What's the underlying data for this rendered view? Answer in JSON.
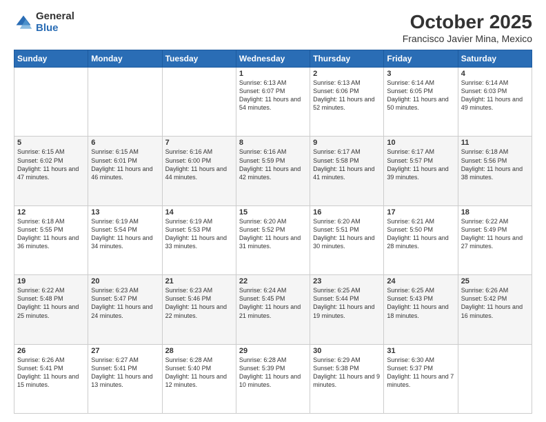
{
  "header": {
    "logo_general": "General",
    "logo_blue": "Blue",
    "month_title": "October 2025",
    "location": "Francisco Javier Mina, Mexico"
  },
  "days_of_week": [
    "Sunday",
    "Monday",
    "Tuesday",
    "Wednesday",
    "Thursday",
    "Friday",
    "Saturday"
  ],
  "weeks": [
    [
      {
        "day": "",
        "sunrise": "",
        "sunset": "",
        "daylight": ""
      },
      {
        "day": "",
        "sunrise": "",
        "sunset": "",
        "daylight": ""
      },
      {
        "day": "",
        "sunrise": "",
        "sunset": "",
        "daylight": ""
      },
      {
        "day": "1",
        "sunrise": "Sunrise: 6:13 AM",
        "sunset": "Sunset: 6:07 PM",
        "daylight": "Daylight: 11 hours and 54 minutes."
      },
      {
        "day": "2",
        "sunrise": "Sunrise: 6:13 AM",
        "sunset": "Sunset: 6:06 PM",
        "daylight": "Daylight: 11 hours and 52 minutes."
      },
      {
        "day": "3",
        "sunrise": "Sunrise: 6:14 AM",
        "sunset": "Sunset: 6:05 PM",
        "daylight": "Daylight: 11 hours and 50 minutes."
      },
      {
        "day": "4",
        "sunrise": "Sunrise: 6:14 AM",
        "sunset": "Sunset: 6:03 PM",
        "daylight": "Daylight: 11 hours and 49 minutes."
      }
    ],
    [
      {
        "day": "5",
        "sunrise": "Sunrise: 6:15 AM",
        "sunset": "Sunset: 6:02 PM",
        "daylight": "Daylight: 11 hours and 47 minutes."
      },
      {
        "day": "6",
        "sunrise": "Sunrise: 6:15 AM",
        "sunset": "Sunset: 6:01 PM",
        "daylight": "Daylight: 11 hours and 46 minutes."
      },
      {
        "day": "7",
        "sunrise": "Sunrise: 6:16 AM",
        "sunset": "Sunset: 6:00 PM",
        "daylight": "Daylight: 11 hours and 44 minutes."
      },
      {
        "day": "8",
        "sunrise": "Sunrise: 6:16 AM",
        "sunset": "Sunset: 5:59 PM",
        "daylight": "Daylight: 11 hours and 42 minutes."
      },
      {
        "day": "9",
        "sunrise": "Sunrise: 6:17 AM",
        "sunset": "Sunset: 5:58 PM",
        "daylight": "Daylight: 11 hours and 41 minutes."
      },
      {
        "day": "10",
        "sunrise": "Sunrise: 6:17 AM",
        "sunset": "Sunset: 5:57 PM",
        "daylight": "Daylight: 11 hours and 39 minutes."
      },
      {
        "day": "11",
        "sunrise": "Sunrise: 6:18 AM",
        "sunset": "Sunset: 5:56 PM",
        "daylight": "Daylight: 11 hours and 38 minutes."
      }
    ],
    [
      {
        "day": "12",
        "sunrise": "Sunrise: 6:18 AM",
        "sunset": "Sunset: 5:55 PM",
        "daylight": "Daylight: 11 hours and 36 minutes."
      },
      {
        "day": "13",
        "sunrise": "Sunrise: 6:19 AM",
        "sunset": "Sunset: 5:54 PM",
        "daylight": "Daylight: 11 hours and 34 minutes."
      },
      {
        "day": "14",
        "sunrise": "Sunrise: 6:19 AM",
        "sunset": "Sunset: 5:53 PM",
        "daylight": "Daylight: 11 hours and 33 minutes."
      },
      {
        "day": "15",
        "sunrise": "Sunrise: 6:20 AM",
        "sunset": "Sunset: 5:52 PM",
        "daylight": "Daylight: 11 hours and 31 minutes."
      },
      {
        "day": "16",
        "sunrise": "Sunrise: 6:20 AM",
        "sunset": "Sunset: 5:51 PM",
        "daylight": "Daylight: 11 hours and 30 minutes."
      },
      {
        "day": "17",
        "sunrise": "Sunrise: 6:21 AM",
        "sunset": "Sunset: 5:50 PM",
        "daylight": "Daylight: 11 hours and 28 minutes."
      },
      {
        "day": "18",
        "sunrise": "Sunrise: 6:22 AM",
        "sunset": "Sunset: 5:49 PM",
        "daylight": "Daylight: 11 hours and 27 minutes."
      }
    ],
    [
      {
        "day": "19",
        "sunrise": "Sunrise: 6:22 AM",
        "sunset": "Sunset: 5:48 PM",
        "daylight": "Daylight: 11 hours and 25 minutes."
      },
      {
        "day": "20",
        "sunrise": "Sunrise: 6:23 AM",
        "sunset": "Sunset: 5:47 PM",
        "daylight": "Daylight: 11 hours and 24 minutes."
      },
      {
        "day": "21",
        "sunrise": "Sunrise: 6:23 AM",
        "sunset": "Sunset: 5:46 PM",
        "daylight": "Daylight: 11 hours and 22 minutes."
      },
      {
        "day": "22",
        "sunrise": "Sunrise: 6:24 AM",
        "sunset": "Sunset: 5:45 PM",
        "daylight": "Daylight: 11 hours and 21 minutes."
      },
      {
        "day": "23",
        "sunrise": "Sunrise: 6:25 AM",
        "sunset": "Sunset: 5:44 PM",
        "daylight": "Daylight: 11 hours and 19 minutes."
      },
      {
        "day": "24",
        "sunrise": "Sunrise: 6:25 AM",
        "sunset": "Sunset: 5:43 PM",
        "daylight": "Daylight: 11 hours and 18 minutes."
      },
      {
        "day": "25",
        "sunrise": "Sunrise: 6:26 AM",
        "sunset": "Sunset: 5:42 PM",
        "daylight": "Daylight: 11 hours and 16 minutes."
      }
    ],
    [
      {
        "day": "26",
        "sunrise": "Sunrise: 6:26 AM",
        "sunset": "Sunset: 5:41 PM",
        "daylight": "Daylight: 11 hours and 15 minutes."
      },
      {
        "day": "27",
        "sunrise": "Sunrise: 6:27 AM",
        "sunset": "Sunset: 5:41 PM",
        "daylight": "Daylight: 11 hours and 13 minutes."
      },
      {
        "day": "28",
        "sunrise": "Sunrise: 6:28 AM",
        "sunset": "Sunset: 5:40 PM",
        "daylight": "Daylight: 11 hours and 12 minutes."
      },
      {
        "day": "29",
        "sunrise": "Sunrise: 6:28 AM",
        "sunset": "Sunset: 5:39 PM",
        "daylight": "Daylight: 11 hours and 10 minutes."
      },
      {
        "day": "30",
        "sunrise": "Sunrise: 6:29 AM",
        "sunset": "Sunset: 5:38 PM",
        "daylight": "Daylight: 11 hours and 9 minutes."
      },
      {
        "day": "31",
        "sunrise": "Sunrise: 6:30 AM",
        "sunset": "Sunset: 5:37 PM",
        "daylight": "Daylight: 11 hours and 7 minutes."
      },
      {
        "day": "",
        "sunrise": "",
        "sunset": "",
        "daylight": ""
      }
    ]
  ]
}
